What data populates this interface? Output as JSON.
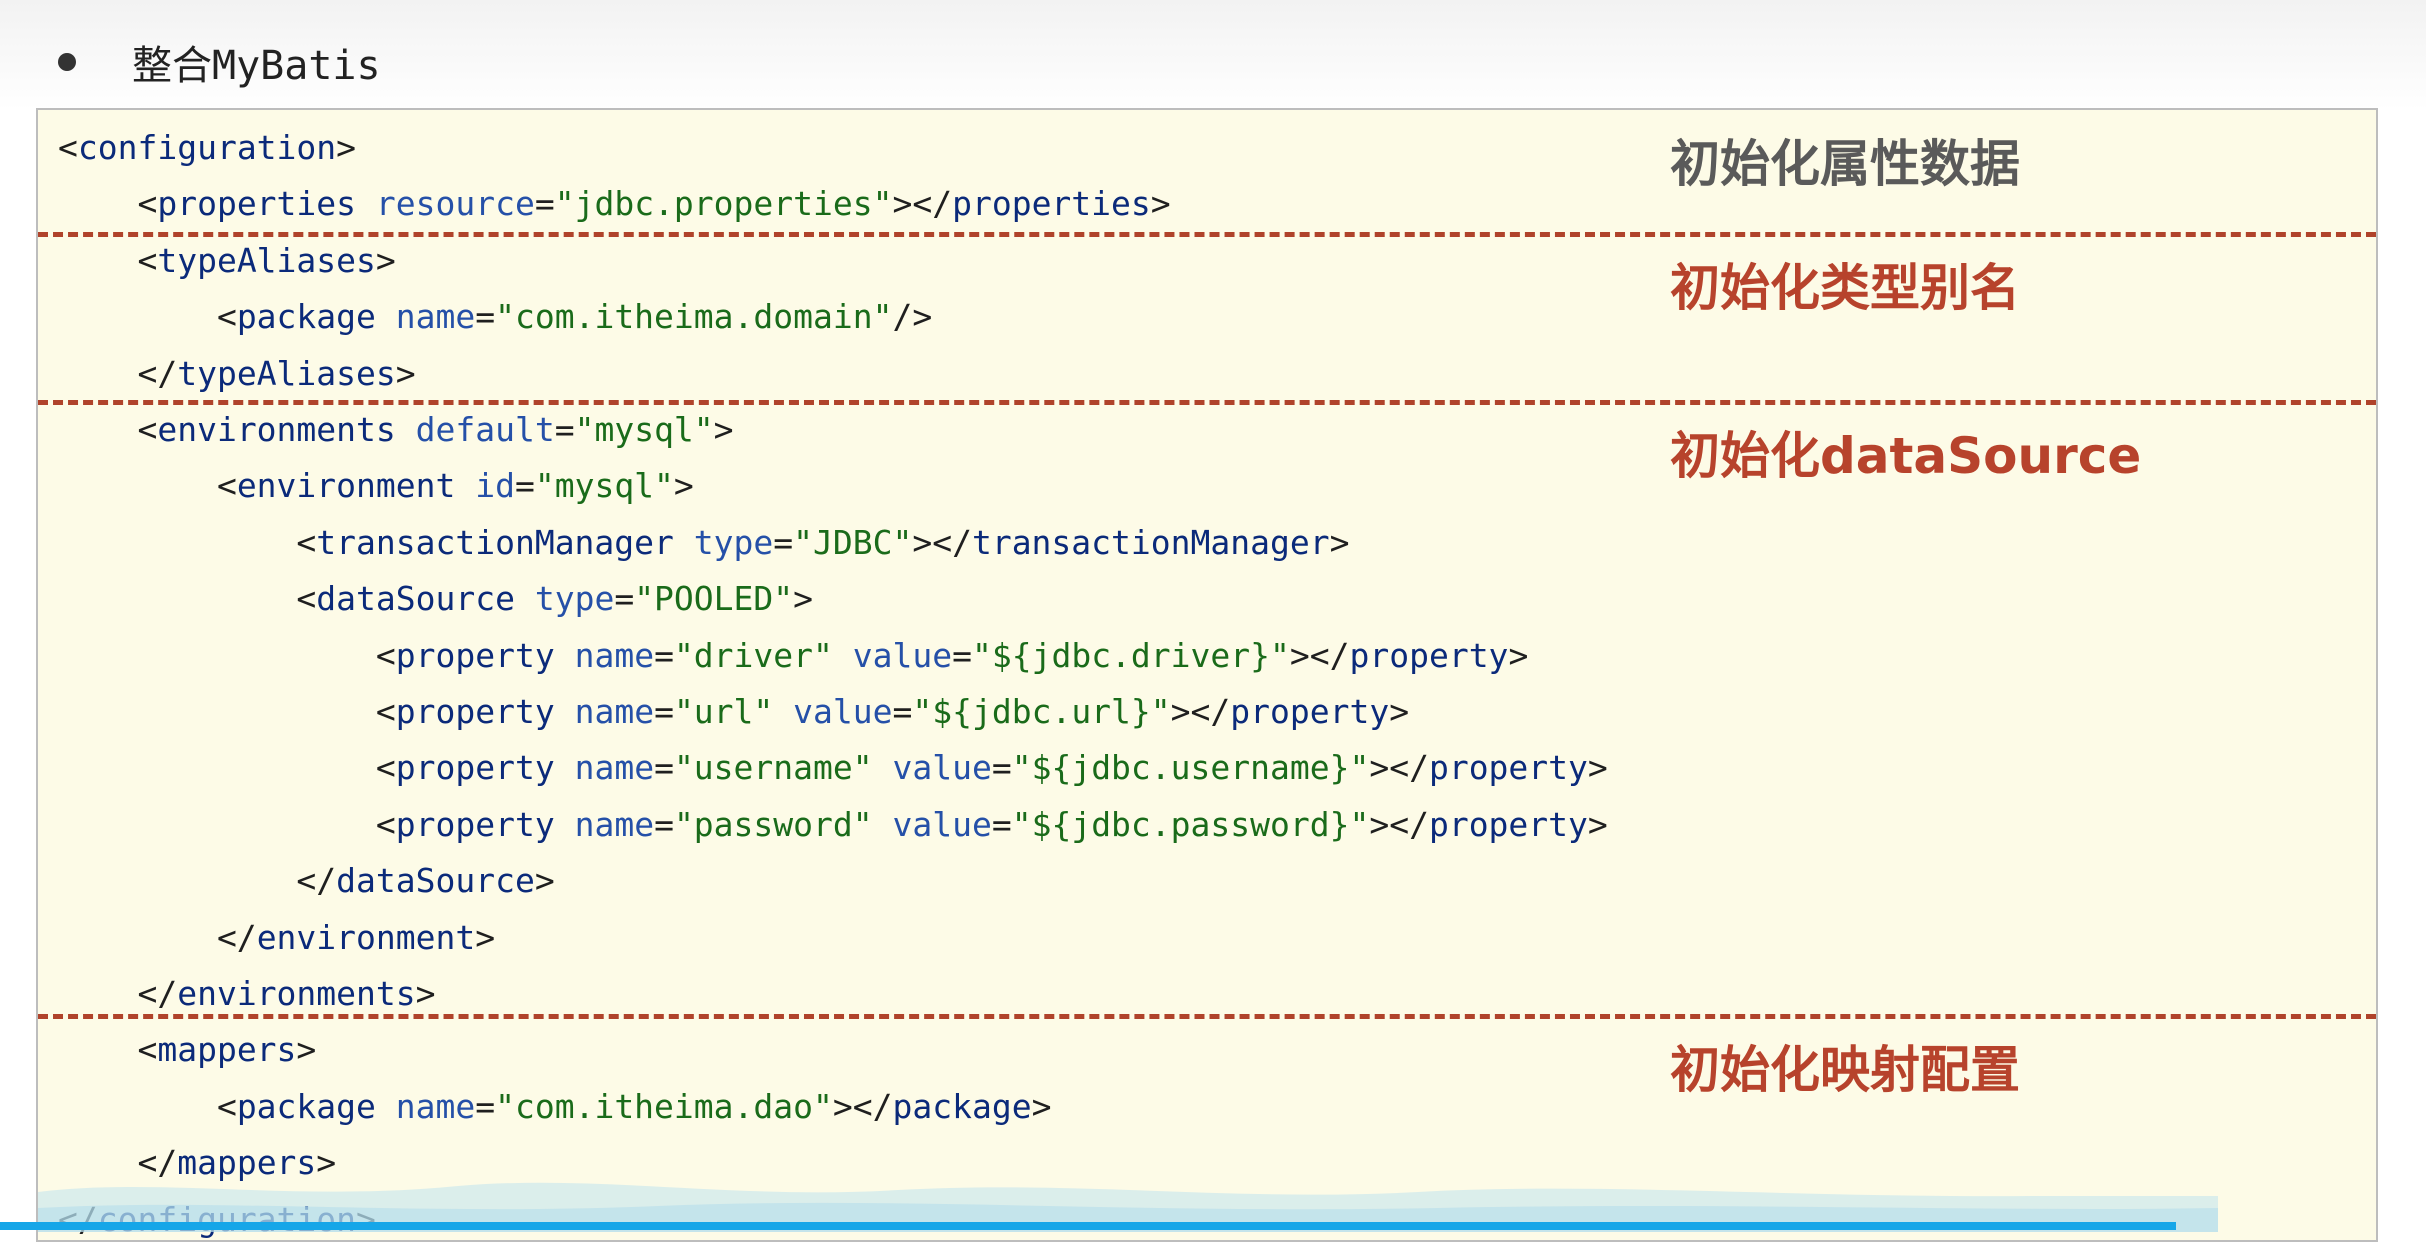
{
  "heading": {
    "title": "整合MyBatis"
  },
  "code": {
    "lines": [
      [
        {
          "t": "<",
          "c": "punc"
        },
        {
          "t": "configuration",
          "c": "tag"
        },
        {
          "t": ">",
          "c": "punc"
        }
      ],
      [
        {
          "t": "    <",
          "c": "punc"
        },
        {
          "t": "properties",
          "c": "tag"
        },
        {
          "t": " resource",
          "c": "attr"
        },
        {
          "t": "=",
          "c": "punc"
        },
        {
          "t": "\"jdbc.properties\"",
          "c": "val"
        },
        {
          "t": "></",
          "c": "punc"
        },
        {
          "t": "properties",
          "c": "tag"
        },
        {
          "t": ">",
          "c": "punc"
        }
      ],
      [
        {
          "t": "    <",
          "c": "punc"
        },
        {
          "t": "typeAliases",
          "c": "tag"
        },
        {
          "t": ">",
          "c": "punc"
        }
      ],
      [
        {
          "t": "        <",
          "c": "punc"
        },
        {
          "t": "package",
          "c": "tag"
        },
        {
          "t": " name",
          "c": "attr"
        },
        {
          "t": "=",
          "c": "punc"
        },
        {
          "t": "\"com.itheima.domain\"",
          "c": "val"
        },
        {
          "t": "/>",
          "c": "punc"
        }
      ],
      [
        {
          "t": "    </",
          "c": "punc"
        },
        {
          "t": "typeAliases",
          "c": "tag"
        },
        {
          "t": ">",
          "c": "punc"
        }
      ],
      [
        {
          "t": "    <",
          "c": "punc"
        },
        {
          "t": "environments",
          "c": "tag"
        },
        {
          "t": " default",
          "c": "attr"
        },
        {
          "t": "=",
          "c": "punc"
        },
        {
          "t": "\"mysql\"",
          "c": "val"
        },
        {
          "t": ">",
          "c": "punc"
        }
      ],
      [
        {
          "t": "        <",
          "c": "punc"
        },
        {
          "t": "environment",
          "c": "tag"
        },
        {
          "t": " id",
          "c": "attr"
        },
        {
          "t": "=",
          "c": "punc"
        },
        {
          "t": "\"mysql\"",
          "c": "val"
        },
        {
          "t": ">",
          "c": "punc"
        }
      ],
      [
        {
          "t": "            <",
          "c": "punc"
        },
        {
          "t": "transactionManager",
          "c": "tag"
        },
        {
          "t": " type",
          "c": "attr"
        },
        {
          "t": "=",
          "c": "punc"
        },
        {
          "t": "\"JDBC\"",
          "c": "val"
        },
        {
          "t": "></",
          "c": "punc"
        },
        {
          "t": "transactionManager",
          "c": "tag"
        },
        {
          "t": ">",
          "c": "punc"
        }
      ],
      [
        {
          "t": "            <",
          "c": "punc"
        },
        {
          "t": "dataSource",
          "c": "tag"
        },
        {
          "t": " type",
          "c": "attr"
        },
        {
          "t": "=",
          "c": "punc"
        },
        {
          "t": "\"POOLED\"",
          "c": "val"
        },
        {
          "t": ">",
          "c": "punc"
        }
      ],
      [
        {
          "t": "                <",
          "c": "punc"
        },
        {
          "t": "property",
          "c": "tag"
        },
        {
          "t": " name",
          "c": "attr"
        },
        {
          "t": "=",
          "c": "punc"
        },
        {
          "t": "\"driver\"",
          "c": "val"
        },
        {
          "t": " value",
          "c": "attr"
        },
        {
          "t": "=",
          "c": "punc"
        },
        {
          "t": "\"${jdbc.driver}\"",
          "c": "val"
        },
        {
          "t": "></",
          "c": "punc"
        },
        {
          "t": "property",
          "c": "tag"
        },
        {
          "t": ">",
          "c": "punc"
        }
      ],
      [
        {
          "t": "                <",
          "c": "punc"
        },
        {
          "t": "property",
          "c": "tag"
        },
        {
          "t": " name",
          "c": "attr"
        },
        {
          "t": "=",
          "c": "punc"
        },
        {
          "t": "\"url\"",
          "c": "val"
        },
        {
          "t": " value",
          "c": "attr"
        },
        {
          "t": "=",
          "c": "punc"
        },
        {
          "t": "\"${jdbc.url}\"",
          "c": "val"
        },
        {
          "t": "></",
          "c": "punc"
        },
        {
          "t": "property",
          "c": "tag"
        },
        {
          "t": ">",
          "c": "punc"
        }
      ],
      [
        {
          "t": "                <",
          "c": "punc"
        },
        {
          "t": "property",
          "c": "tag"
        },
        {
          "t": " name",
          "c": "attr"
        },
        {
          "t": "=",
          "c": "punc"
        },
        {
          "t": "\"username\"",
          "c": "val"
        },
        {
          "t": " value",
          "c": "attr"
        },
        {
          "t": "=",
          "c": "punc"
        },
        {
          "t": "\"${jdbc.username}\"",
          "c": "val"
        },
        {
          "t": "></",
          "c": "punc"
        },
        {
          "t": "property",
          "c": "tag"
        },
        {
          "t": ">",
          "c": "punc"
        }
      ],
      [
        {
          "t": "                <",
          "c": "punc"
        },
        {
          "t": "property",
          "c": "tag"
        },
        {
          "t": " name",
          "c": "attr"
        },
        {
          "t": "=",
          "c": "punc"
        },
        {
          "t": "\"password\"",
          "c": "val"
        },
        {
          "t": " value",
          "c": "attr"
        },
        {
          "t": "=",
          "c": "punc"
        },
        {
          "t": "\"${jdbc.password}\"",
          "c": "val"
        },
        {
          "t": "></",
          "c": "punc"
        },
        {
          "t": "property",
          "c": "tag"
        },
        {
          "t": ">",
          "c": "punc"
        }
      ],
      [
        {
          "t": "            </",
          "c": "punc"
        },
        {
          "t": "dataSource",
          "c": "tag"
        },
        {
          "t": ">",
          "c": "punc"
        }
      ],
      [
        {
          "t": "        </",
          "c": "punc"
        },
        {
          "t": "environment",
          "c": "tag"
        },
        {
          "t": ">",
          "c": "punc"
        }
      ],
      [
        {
          "t": "    </",
          "c": "punc"
        },
        {
          "t": "environments",
          "c": "tag"
        },
        {
          "t": ">",
          "c": "punc"
        }
      ],
      [
        {
          "t": "    <",
          "c": "punc"
        },
        {
          "t": "mappers",
          "c": "tag"
        },
        {
          "t": ">",
          "c": "punc"
        }
      ],
      [
        {
          "t": "        <",
          "c": "punc"
        },
        {
          "t": "package",
          "c": "tag"
        },
        {
          "t": " name",
          "c": "attr"
        },
        {
          "t": "=",
          "c": "punc"
        },
        {
          "t": "\"com.itheima.dao\"",
          "c": "val"
        },
        {
          "t": "></",
          "c": "punc"
        },
        {
          "t": "package",
          "c": "tag"
        },
        {
          "t": ">",
          "c": "punc"
        }
      ],
      [
        {
          "t": "    </",
          "c": "punc"
        },
        {
          "t": "mappers",
          "c": "tag"
        },
        {
          "t": ">",
          "c": "punc"
        }
      ],
      [
        {
          "t": "</",
          "c": "punc"
        },
        {
          "t": "configuration",
          "c": "tag"
        },
        {
          "t": ">",
          "c": "punc"
        }
      ]
    ]
  },
  "sections": [
    {
      "label": "初始化属性数据",
      "style": "gray"
    },
    {
      "label": "初始化类型别名",
      "style": "red"
    },
    {
      "label": "初始化dataSource",
      "style": "red"
    },
    {
      "label": "初始化映射配置",
      "style": "red"
    }
  ],
  "colors": {
    "divider": "#b0432b",
    "label_red": "#b7432c",
    "label_gray": "#5a5a5a",
    "tag": "#0b2a7a",
    "attr": "#2550a8",
    "value": "#1a6b1a",
    "progress": "#16a6e8"
  },
  "video_progress": {
    "fraction": 0.897
  }
}
